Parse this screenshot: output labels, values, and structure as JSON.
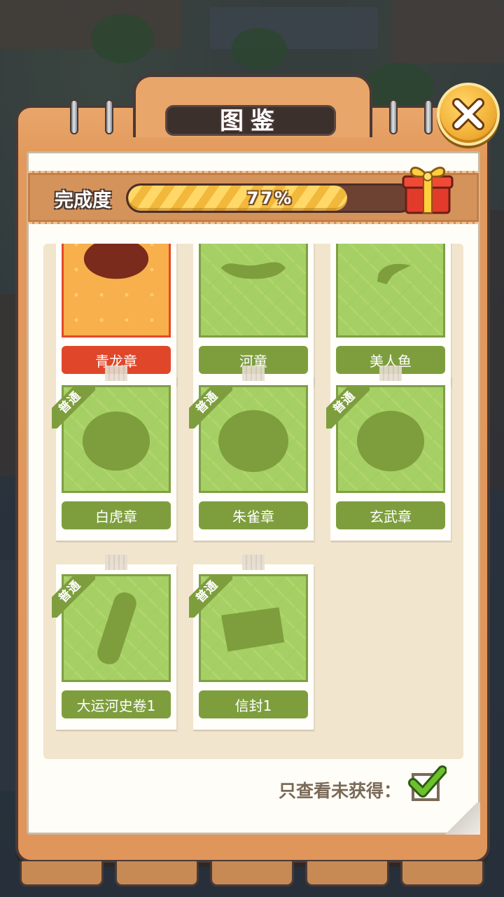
{
  "dialog": {
    "title": "图鉴",
    "close_icon": "close-x-icon"
  },
  "progress": {
    "label": "完成度",
    "percent": 77,
    "text": "77%",
    "reward_icon": "gift-box-icon"
  },
  "cards": [
    {
      "name": "青龙章",
      "rarity": "",
      "silhouette": "seal-partial",
      "style": "red"
    },
    {
      "name": "河童",
      "rarity": "",
      "silhouette": "kappa",
      "style": "green"
    },
    {
      "name": "美人鱼",
      "rarity": "",
      "silhouette": "mermaid",
      "style": "green"
    },
    {
      "name": "白虎章",
      "rarity": "普通",
      "silhouette": "round-seal",
      "style": "green"
    },
    {
      "name": "朱雀章",
      "rarity": "普通",
      "silhouette": "round-seal",
      "style": "green"
    },
    {
      "name": "玄武章",
      "rarity": "普通",
      "silhouette": "round-seal",
      "style": "green"
    },
    {
      "name": "大运河史卷1",
      "rarity": "普通",
      "silhouette": "scroll",
      "style": "green"
    },
    {
      "name": "信封1",
      "rarity": "普通",
      "silhouette": "envelope",
      "style": "green"
    }
  ],
  "filter": {
    "label": "只查看未获得：",
    "checked": true
  },
  "colors": {
    "frame": "#e2995c",
    "card_green": "#7e9e3e",
    "card_red": "#e0462a",
    "progress_fill": "#f1b83b"
  }
}
